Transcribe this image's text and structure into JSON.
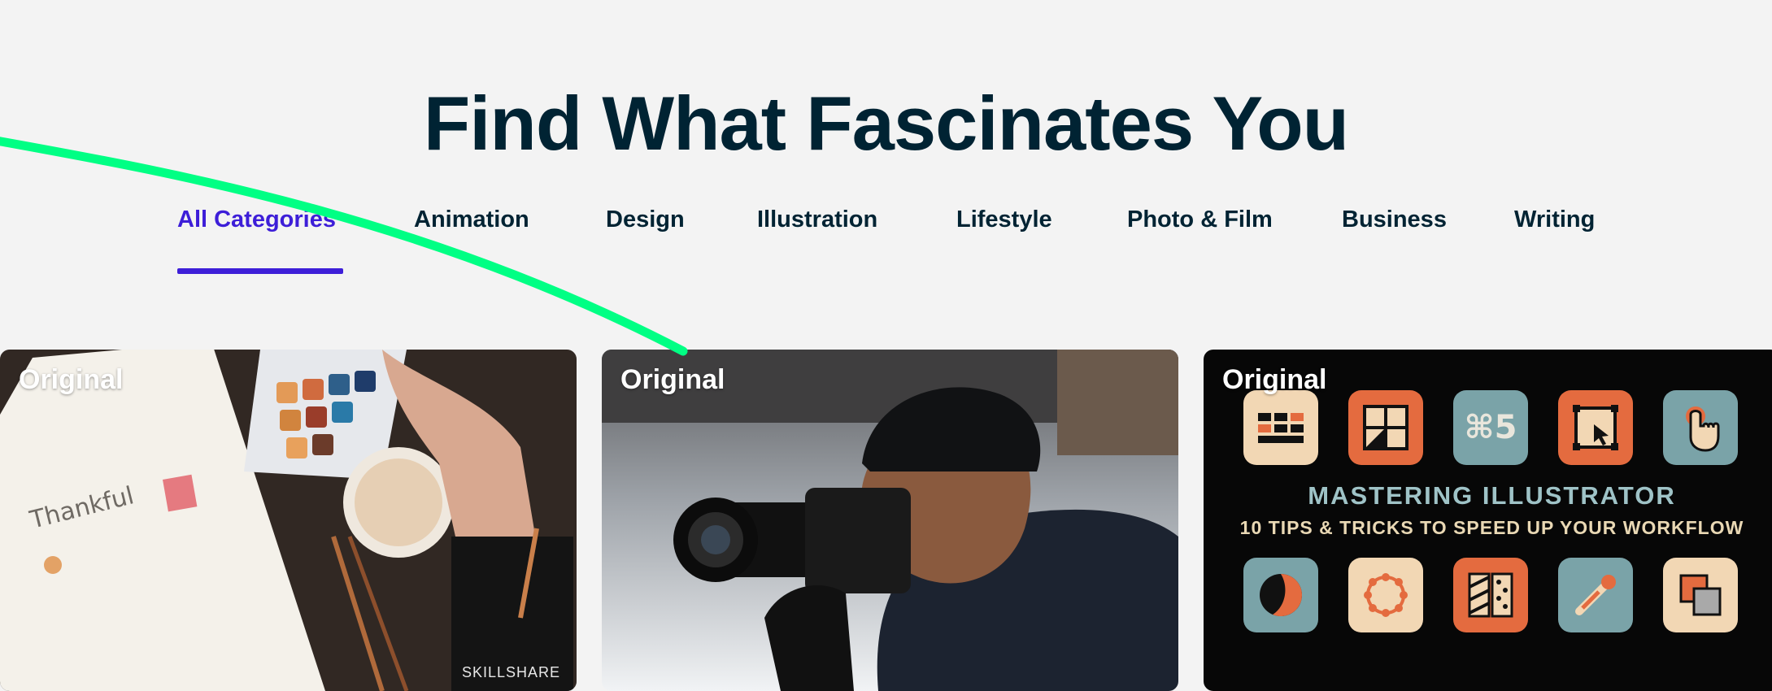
{
  "section": {
    "title": "Find What Fascinates You"
  },
  "tabs": [
    {
      "label": "All Categories",
      "active": true
    },
    {
      "label": "Animation"
    },
    {
      "label": "Design"
    },
    {
      "label": "Illustration"
    },
    {
      "label": "Lifestyle"
    },
    {
      "label": "Photo & Film"
    },
    {
      "label": "Business"
    },
    {
      "label": "Writing"
    }
  ],
  "cards": [
    {
      "badge": "Original",
      "watermark": "SKILLSHARE",
      "image": "watercolor-journal-photo"
    },
    {
      "badge": "Original",
      "image": "photographer-with-camera-photo"
    },
    {
      "badge": "Original",
      "image": "illustrator-tips-graphic",
      "graphic_title": "MASTERING ILLUSTRATOR",
      "graphic_subtitle": "10 TIPS & TRICKS TO SPEED UP YOUR WORKFLOW",
      "shortcut_label": "⌘5"
    }
  ],
  "colors": {
    "background": "#f3f3f3",
    "heading": "#002333",
    "active_tab": "#3d1ed8",
    "swoosh": "#00ff84"
  }
}
